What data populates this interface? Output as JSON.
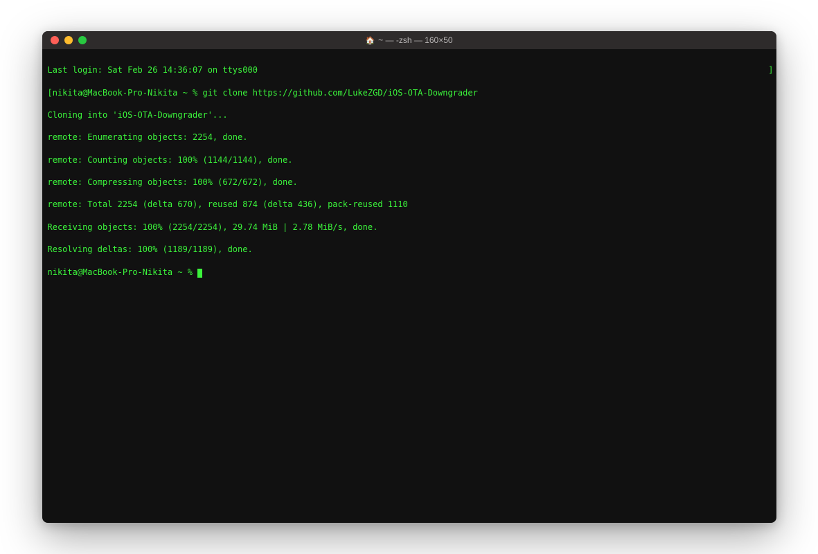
{
  "titlebar": {
    "home_icon": "🏠",
    "title": "~ — -zsh — 160×50"
  },
  "terminal": {
    "lines": [
      "Last login: Sat Feb 26 14:36:07 on ttys000",
      "[nikita@MacBook-Pro-Nikita ~ % git clone https://github.com/LukeZGD/iOS-OTA-Downgrader",
      "Cloning into 'iOS-OTA-Downgrader'...",
      "remote: Enumerating objects: 2254, done.",
      "remote: Counting objects: 100% (1144/1144), done.",
      "remote: Compressing objects: 100% (672/672), done.",
      "remote: Total 2254 (delta 670), reused 874 (delta 436), pack-reused 1110",
      "Receiving objects: 100% (2254/2254), 29.74 MiB | 2.78 MiB/s, done.",
      "Resolving deltas: 100% (1189/1189), done."
    ],
    "prompt": "nikita@MacBook-Pro-Nikita ~ % ",
    "right_bracket": "]"
  }
}
